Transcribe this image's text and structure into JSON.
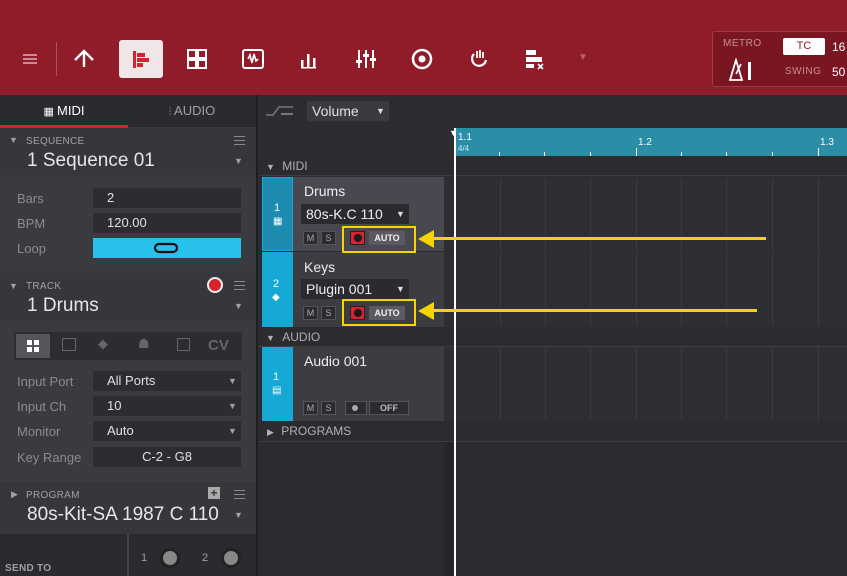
{
  "toolbar": {
    "icons": [
      "menu-icon",
      "home-icon",
      "track-view-icon",
      "grid-view-icon",
      "sample-edit-icon",
      "mixer-bars-icon",
      "mixer-icon",
      "record-icon",
      "loop-icon",
      "program-icon"
    ],
    "metro_label": "METRO",
    "swing_label": "SWING",
    "tc_label": "TC",
    "tc_value": "16",
    "swing_value": "50"
  },
  "tabs": {
    "midi": "MIDI",
    "audio": "AUDIO"
  },
  "sequence": {
    "section_label": "SEQUENCE",
    "name": "1 Sequence 01",
    "bars_label": "Bars",
    "bars_value": "2",
    "bpm_label": "BPM",
    "bpm_value": "120.00",
    "loop_label": "Loop"
  },
  "track": {
    "section_label": "TRACK",
    "name": "1 Drums",
    "input_port_label": "Input Port",
    "input_port_value": "All Ports",
    "input_ch_label": "Input Ch",
    "input_ch_value": "10",
    "monitor_label": "Monitor",
    "monitor_value": "Auto",
    "key_range_label": "Key Range",
    "key_range_value": "C-2 - G8",
    "type_cv": "CV"
  },
  "program": {
    "section_label": "PROGRAM",
    "name": "80s-Kit-SA 1987 C 110"
  },
  "send": {
    "label": "SEND TO",
    "send1": "1",
    "send2": "2"
  },
  "automation": {
    "param": "Volume"
  },
  "ruler": {
    "m1": "1.1",
    "m1_sub": "4/4",
    "m2": "1.2",
    "m3": "1.3"
  },
  "groups": {
    "midi": "MIDI",
    "audio": "AUDIO",
    "programs": "PROGRAMS"
  },
  "tracks": [
    {
      "num": "1",
      "name": "Drums",
      "program": "80s-K.C 110",
      "mute": "M",
      "solo": "S",
      "auto": "AUTO"
    },
    {
      "num": "2",
      "name": "Keys",
      "program": "Plugin 001",
      "mute": "M",
      "solo": "S",
      "auto": "AUTO"
    },
    {
      "num": "1",
      "name": "Audio 001",
      "mute": "M",
      "solo": "S",
      "auto": "OFF"
    }
  ],
  "colors": {
    "toolbar": "#8f1c28",
    "accent_blue": "#16a8d4",
    "record_red": "#d6232f",
    "highlight_yellow": "#f5d400"
  }
}
